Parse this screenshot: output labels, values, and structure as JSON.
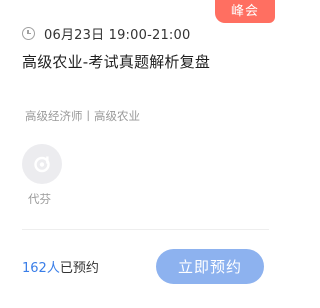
{
  "badge": "峰会",
  "schedule": "06月23日 19:00-21:00",
  "title": "高级农业-考试真题解析复盘",
  "tags": "高级经济师丨高级农业",
  "teacher": {
    "name": "代芬"
  },
  "stats": {
    "count": "162人",
    "suffix": "已预约"
  },
  "action": {
    "label": "立即预约"
  },
  "colors": {
    "badge": "#ff6f61",
    "accent": "#3a7ee8",
    "button": "#8db2ef"
  },
  "icons": [
    "clock-icon",
    "avatar-logo-icon"
  ]
}
